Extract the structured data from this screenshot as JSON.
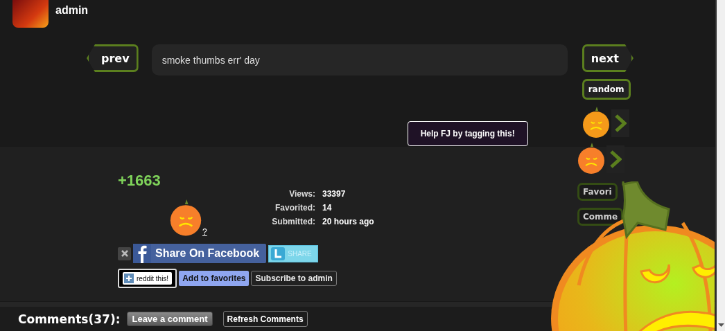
{
  "user": {
    "name": "admin"
  },
  "nav": {
    "prev": "prev",
    "title": "smoke thumbs err' day",
    "next": "next",
    "random": "random"
  },
  "tag_prompt": "Help FJ by tagging this!",
  "score": "+1663",
  "vote_help": "?",
  "stats": [
    {
      "label": "Views:",
      "value": "33397"
    },
    {
      "label": "Favorited:",
      "value": "14"
    },
    {
      "label": "Submitted:",
      "value": "20 hours ago"
    }
  ],
  "share": {
    "facebook": "Share On Facebook",
    "twitter": "SHARE"
  },
  "actions": [
    {
      "kind": "reddit",
      "label": "reddit this!"
    },
    {
      "kind": "favorite",
      "label": "Add to favorites"
    },
    {
      "kind": "subscribe",
      "label": "Subscribe to admin"
    }
  ],
  "side_buttons": [
    "Favori",
    "Comme"
  ],
  "comments": {
    "heading": "Comments(37):",
    "leave": "Leave a comment",
    "refresh": "Refresh Comments"
  }
}
